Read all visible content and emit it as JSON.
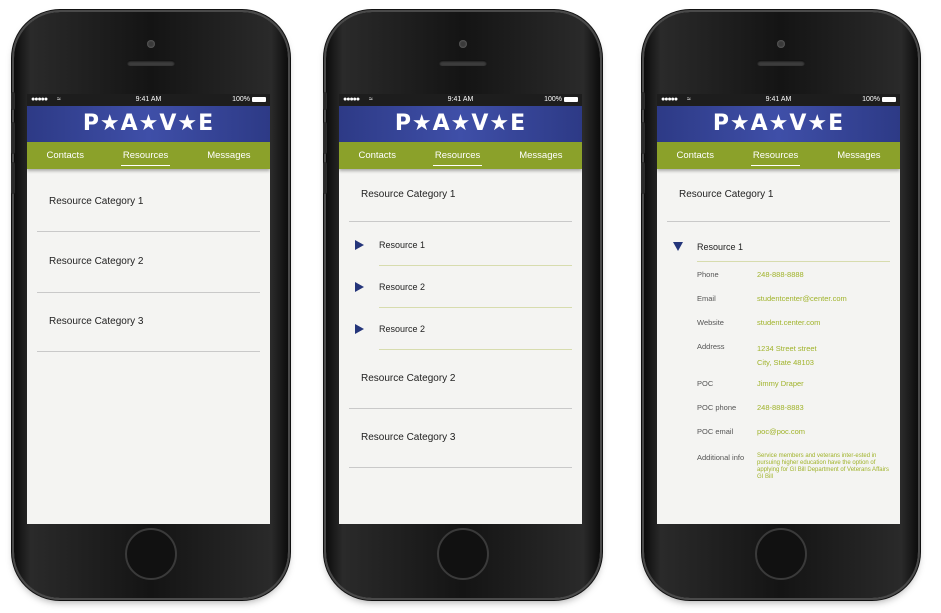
{
  "status": {
    "signal": "●●●●●",
    "time": "9:41 AM",
    "battery": "100%"
  },
  "logo": "P★A★V★E",
  "tabs": [
    "Contacts",
    "Resources",
    "Messages"
  ],
  "screens": [
    {
      "categories": [
        "Resource Category 1",
        "Resource Category 2",
        "Resource Category 3"
      ]
    },
    {
      "categories": [
        "Resource Category 1",
        "Resource Category 2",
        "Resource Category 3"
      ],
      "resources": [
        "Resource 1",
        "Resource 2",
        "Resource 2"
      ]
    },
    {
      "category": "Resource Category 1",
      "resource": "Resource 1",
      "details": [
        {
          "label": "Phone",
          "value": "248-888-8888"
        },
        {
          "label": "Email",
          "value": "studentcenter@center.com"
        },
        {
          "label": "Website",
          "value": "student.center.com"
        },
        {
          "label": "Address",
          "value": "1234 Street street",
          "value2": "City, State 48103"
        },
        {
          "label": "POC",
          "value": "Jimmy Draper"
        },
        {
          "label": "POC phone",
          "value": "248-888-8883"
        },
        {
          "label": "POC email",
          "value": "poc@poc.com"
        },
        {
          "label": "Additional info",
          "value": "Service members and veterans inter-ested in pursuing higher education have the option of applying for GI Bill Department of Veterans Affairs  GI Bill"
        }
      ]
    }
  ],
  "colors": {
    "header": "#2d3a86",
    "tabbar": "#8ba12a",
    "accent_text": "#a0b32a",
    "triangle": "#24357a"
  },
  "icons": {
    "expand": "triangle-right-icon",
    "collapse": "triangle-down-icon"
  }
}
